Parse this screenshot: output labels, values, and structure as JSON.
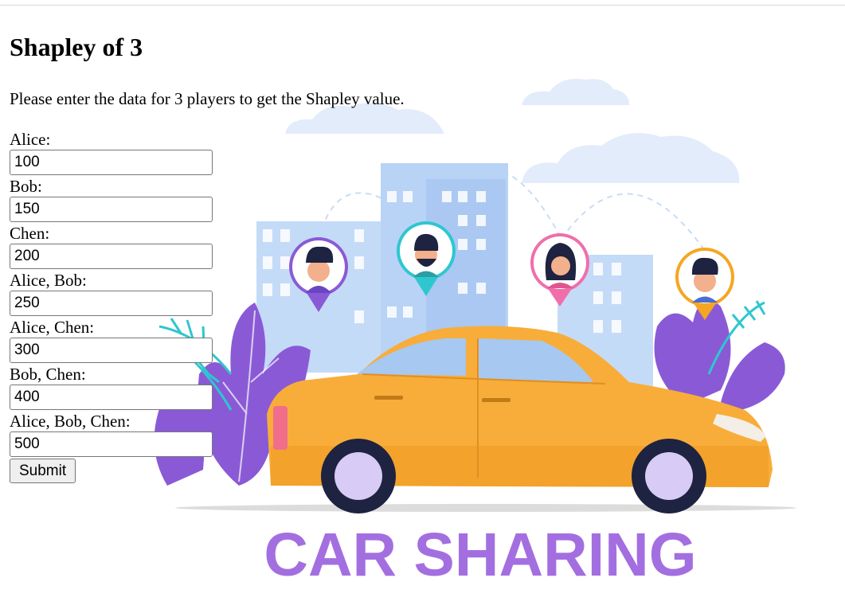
{
  "page": {
    "title": "Shapley of 3",
    "intro": "Please enter the data for 3 players to get the Shapley value."
  },
  "form": {
    "fields": [
      {
        "label": "Alice:",
        "value": "100"
      },
      {
        "label": "Bob:",
        "value": "150"
      },
      {
        "label": "Chen:",
        "value": "200"
      },
      {
        "label": "Alice, Bob:",
        "value": "250"
      },
      {
        "label": "Alice, Chen:",
        "value": "300"
      },
      {
        "label": "Bob, Chen:",
        "value": "400"
      },
      {
        "label": "Alice, Bob, Chen:",
        "value": "500"
      }
    ],
    "submit_label": "Submit"
  },
  "illustration": {
    "caption": "CAR SHARING",
    "colors": {
      "car": "#f8ad3a",
      "caption": "#a36fe0",
      "buildings": "#b9d3f6",
      "leaves": "#8a5ad6",
      "palms": "#2ec7cf"
    }
  }
}
